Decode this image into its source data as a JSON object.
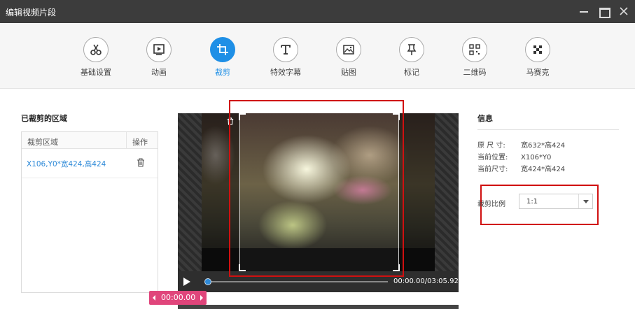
{
  "window": {
    "title": "编辑视频片段"
  },
  "toolbar": {
    "tools": [
      {
        "label": "基础设置",
        "icon": "scissors-icon"
      },
      {
        "label": "动画",
        "icon": "play-frame-icon"
      },
      {
        "label": "裁剪",
        "icon": "crop-icon",
        "active": true
      },
      {
        "label": "特效字幕",
        "icon": "text-t-icon"
      },
      {
        "label": "贴图",
        "icon": "image-icon"
      },
      {
        "label": "标记",
        "icon": "pin-icon"
      },
      {
        "label": "二维码",
        "icon": "qrcode-icon"
      },
      {
        "label": "马赛克",
        "icon": "mosaic-icon"
      }
    ],
    "accent_color": "#1e8fe6"
  },
  "cropped_regions": {
    "title": "已裁剪的区域",
    "columns": [
      "裁剪区域",
      "操作"
    ],
    "rows": [
      {
        "region": "X106,Y0*宽424,高424"
      }
    ]
  },
  "player": {
    "time": "00:00.00/03:05.92",
    "marker_time": "00:00.00",
    "progress": 0
  },
  "info": {
    "title": "信息",
    "rows": [
      {
        "key": "原 尺 寸:",
        "value": "宽632*高424"
      },
      {
        "key": "当前位置:",
        "value": "X106*Y0"
      },
      {
        "key": "当前尺寸:",
        "value": "宽424*高424"
      }
    ],
    "ratio_label": "裁剪比例",
    "ratio_value": "1:1"
  }
}
